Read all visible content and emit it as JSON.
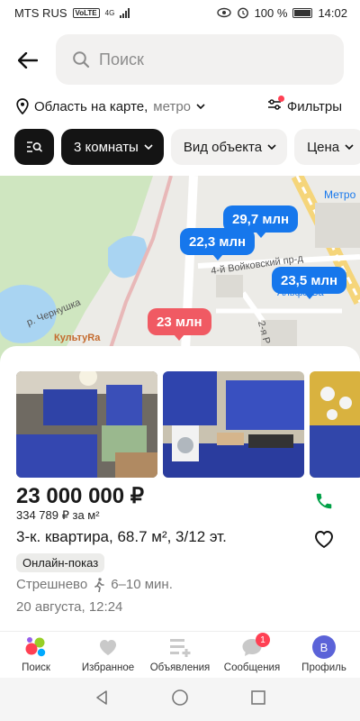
{
  "status_bar": {
    "carrier": "MTS RUS",
    "volte": "VoLTE",
    "network": "4G",
    "battery": "100 %",
    "time": "14:02"
  },
  "header": {
    "search_placeholder": "Поиск"
  },
  "location": {
    "label": "Область на карте,",
    "metro": "метро",
    "filters_label": "Фильтры"
  },
  "chips": [
    {
      "label": "3 комнаты"
    },
    {
      "label": "Вид объекта"
    },
    {
      "label": "Цена"
    }
  ],
  "map": {
    "pins": [
      {
        "price": "29,7 млн"
      },
      {
        "price": "22,3 млн"
      },
      {
        "price": "23,5 млн"
      },
      {
        "price": "23 млн"
      }
    ],
    "labels": {
      "metro": "Метро",
      "street1": "4-й Войковский пр-д",
      "lake": "р. Чернушка",
      "place": "КультуRa",
      "bank": "Альфа-Ба",
      "street2": "2-я Р"
    }
  },
  "listing": {
    "price": "23 000 000 ₽",
    "price_per_m2": "334 789 ₽ за м²",
    "title": "3-к. квартира, 68.7 м², 3/12 эт.",
    "badge": "Онлайн-показ",
    "metro": "Стрешнево",
    "walk_time": "6–10 мин.",
    "date": "20 августа, 12:24"
  },
  "bottom_nav": [
    {
      "label": "Поиск"
    },
    {
      "label": "Избранное"
    },
    {
      "label": "Объявления"
    },
    {
      "label": "Сообщения",
      "badge": "1"
    },
    {
      "label": "Профиль",
      "avatar": "В"
    }
  ],
  "colors": {
    "accent_blue": "#1677ec",
    "accent_red": "#f05a63",
    "call_green": "#00a046"
  }
}
